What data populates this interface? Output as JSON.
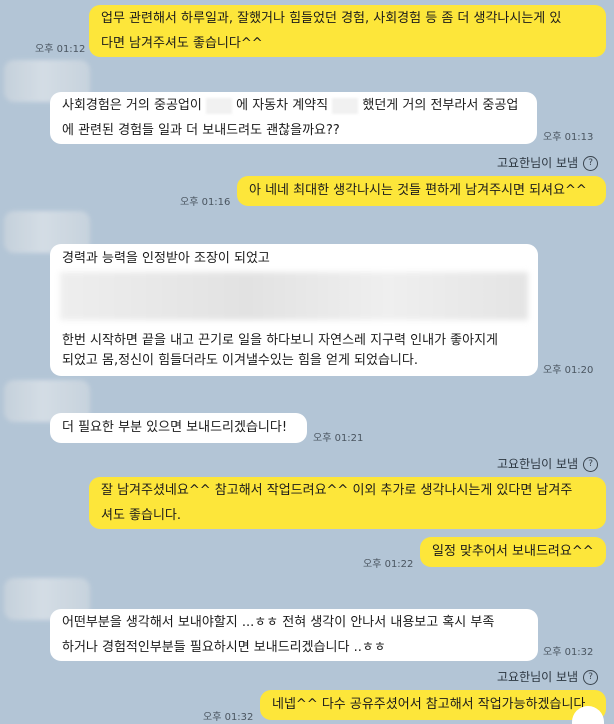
{
  "messages": {
    "m1": {
      "lines": [
        "업무 관련해서 하루일과, 잘했거나 힘들었던 경험, 사회경험 등 좀 더 생각나시는게 있",
        "다면 남겨주셔도 좋습니다^^"
      ],
      "time": "오후 01:12"
    },
    "m2": {
      "line1_a": "사회경험은 거의 중공업이",
      "line1_b": "에 자동차 계약직",
      "line1_c": "했던게 거의 전부라서 중공업",
      "line2": "에 관련된 경험들 일과 더 보내드려도 괜찮을까요??",
      "time": "오후 01:13"
    },
    "sender1": "고요한님이 보냄",
    "m3": {
      "text": "아 네네 최대한 생각나시는 것들 편하게 남겨주시면 되셔요^^",
      "time": "오후 01:16"
    },
    "m4": {
      "line1": "경력과 능력을 인정받아 조장이 되었고",
      "line2": "한번 시작하면 끝을 내고 끈기로 일을 하다보니 자연스레 지구력 인내가 좋아지게",
      "line3": "되었고 몸,정신이 힘들더라도 이겨낼수있는 힘을 얻게 되었습니다.",
      "time": "오후 01:20"
    },
    "m5": {
      "text": "더 필요한 부분 있으면 보내드리겠습니다!",
      "time": "오후 01:21"
    },
    "sender2": "고요한님이 보냄",
    "m6": {
      "lines": [
        "잘 남겨주셨네요^^ 참고해서 작업드려요^^ 이외 추가로 생각나시는게 있다면 남겨주",
        "셔도 좋습니다."
      ]
    },
    "m7": {
      "text": "일정 맞추어서 보내드려요^^",
      "time": "오후 01:22"
    },
    "m8": {
      "line1": "어떤부분을 생각해서 보내야할지 ...ㅎㅎ 전혀 생각이 안나서 내용보고 혹시 부족",
      "line2": "하거나 경험적인부분들 필요하시면 보내드리겠습니다 ..ㅎㅎ",
      "time": "오후 01:32"
    },
    "sender3": "고요한님이 보냄",
    "m9": {
      "text": "네넵^^ 다수 공유주셨어서 참고해서 작업가능하겠습니다",
      "time": "오후 01:32"
    },
    "colors": {
      "bg": "#b3c5d6",
      "mine": "#fde63a",
      "theirs": "#ffffff"
    }
  }
}
